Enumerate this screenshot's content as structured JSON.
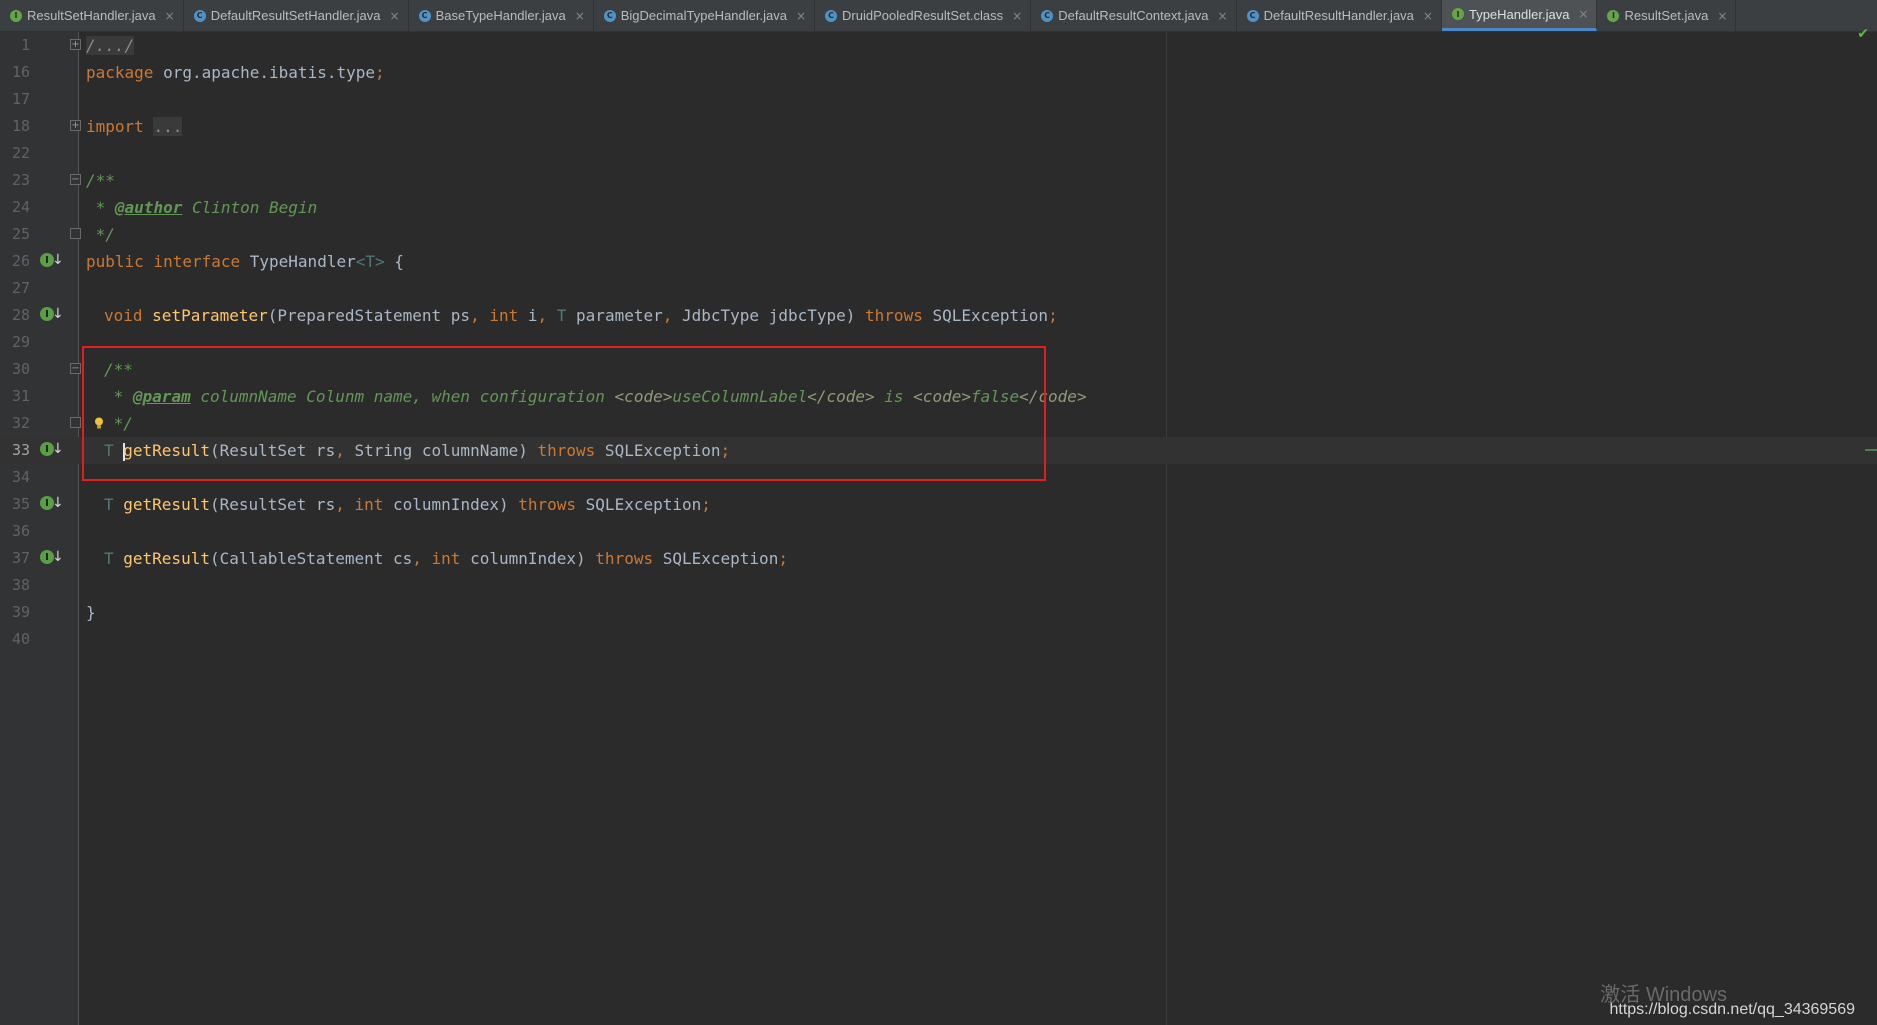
{
  "tabs": [
    {
      "label": "ResultSetHandler.java",
      "icon": "interface-icon",
      "active": false
    },
    {
      "label": "DefaultResultSetHandler.java",
      "icon": "class-icon",
      "active": false
    },
    {
      "label": "BaseTypeHandler.java",
      "icon": "class-icon",
      "active": false
    },
    {
      "label": "BigDecimalTypeHandler.java",
      "icon": "class-icon",
      "active": false
    },
    {
      "label": "DruidPooledResultSet.class",
      "icon": "class-icon",
      "active": false
    },
    {
      "label": "DefaultResultContext.java",
      "icon": "class-icon",
      "active": false
    },
    {
      "label": "DefaultResultHandler.java",
      "icon": "class-icon",
      "active": false
    },
    {
      "label": "TypeHandler.java",
      "icon": "interface-icon",
      "active": true
    },
    {
      "label": "ResultSet.java",
      "icon": "interface-icon",
      "active": false
    }
  ],
  "tab_close": "×",
  "lines": {
    "n1": "1",
    "n16": "16",
    "n17": "17",
    "n18": "18",
    "n22": "22",
    "n23": "23",
    "n24": "24",
    "n25": "25",
    "n26": "26",
    "n27": "27",
    "n28": "28",
    "n29": "29",
    "n30": "30",
    "n31": "31",
    "n32": "32",
    "n33": "33",
    "n34": "34",
    "n35": "35",
    "n36": "36",
    "n37": "37",
    "n38": "38",
    "n39": "39",
    "n40": "40"
  },
  "code": {
    "l1_fold": "/.../",
    "l16_kw": "package",
    "l16_pkg": " org.apache.ibatis.type",
    "l16_semi": ";",
    "l18_kw": "import",
    "l18_fold": "...",
    "l23": "/**",
    "l24_star": " * ",
    "l24_tag": "@author",
    "l24_text": " Clinton Begin",
    "l25": " */",
    "l26_kw": "public interface",
    "l26_name": " TypeHandler",
    "l26_gen": "<T>",
    "l26_brace": " {",
    "l28_kw": "void",
    "l28_fn": "setParameter",
    "l28_p1": "(PreparedStatement ps",
    "l28_c1": ", ",
    "l28_int": "int",
    "l28_p2": " i",
    "l28_c2": ", ",
    "l28_t": "T",
    "l28_p3": " parameter",
    "l28_c3": ", ",
    "l28_p4": "JdbcType jdbcType) ",
    "l28_throws": "throws",
    "l28_ex": " SQLException",
    "l28_semi": ";",
    "l30": "/**",
    "l31_star": " * ",
    "l31_tag": "@param",
    "l31_text1": " columnName Colunm name, when configuration ",
    "l31_code1": "<code>",
    "l31_text2": "useColumnLabel",
    "l31_code2": "</code>",
    "l31_text3": " is ",
    "l31_code3": "<code>",
    "l31_text4": "false",
    "l31_code4": "</code>",
    "l32": " */",
    "l33_t": "T ",
    "l33_fn": "getResult",
    "l33_p": "(ResultSet rs",
    "l33_c": ", ",
    "l33_p2": "String columnName) ",
    "l33_throws": "throws",
    "l33_ex": " SQLException",
    "l33_semi": ";",
    "l35_t": "T ",
    "l35_fn": "getResult",
    "l35_p": "(ResultSet rs",
    "l35_c": ", ",
    "l35_int": "int",
    "l35_p2": " columnIndex) ",
    "l35_throws": "throws",
    "l35_ex": " SQLException",
    "l35_semi": ";",
    "l37_t": "T ",
    "l37_fn": "getResult",
    "l37_p": "(CallableStatement cs",
    "l37_c": ", ",
    "l37_int": "int",
    "l37_p2": " columnIndex) ",
    "l37_throws": "throws",
    "l37_ex": " SQLException",
    "l37_semi": ";",
    "l39": "}"
  },
  "gutter_icon_letter": "I",
  "status_check": "✔",
  "watermark": "https://blog.csdn.net/qq_34369569",
  "watermark_bg": "激活 Windows",
  "colors": {
    "background": "#2b2b2b",
    "keyword": "#cc7832",
    "method": "#ffc66d",
    "comment": "#629755",
    "highlight_box": "#e02020",
    "active_tab_underline": "#4a88c7"
  }
}
